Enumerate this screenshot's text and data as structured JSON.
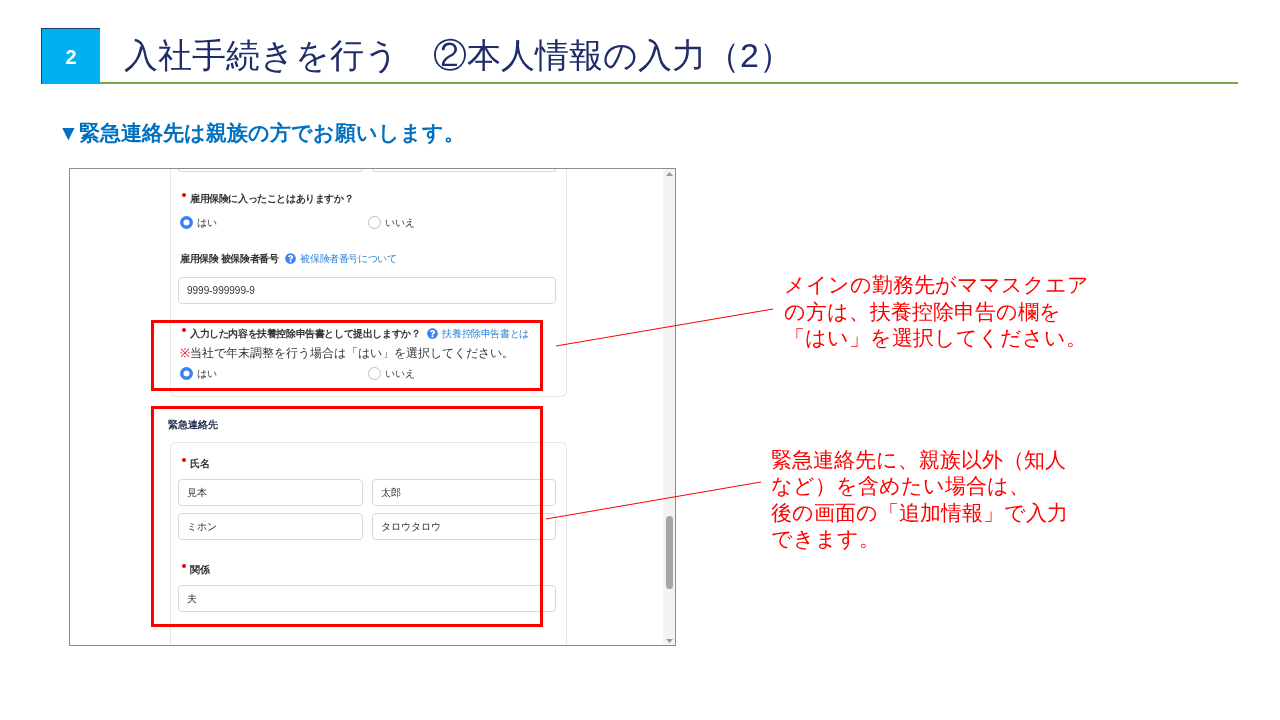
{
  "header": {
    "number": "2",
    "title": "入社手続きを行う　②本人情報の入力（2）"
  },
  "subtitle": "▼緊急連絡先は親族の方でお願いします。",
  "form": {
    "section_1": {
      "items": [
        {
          "kind": "radio",
          "label": "雇用保険に入ったことはありますか？",
          "required": true,
          "options": [
            {
              "label": "はい",
              "selected": true
            },
            {
              "label": "いいえ",
              "selected": false
            }
          ]
        },
        {
          "kind": "text",
          "label": "雇用保険 被保険者番号",
          "required": false,
          "help_link": "被保険者番号について",
          "values": [
            "9999-999999-9"
          ]
        },
        {
          "kind": "radio",
          "label": "入力した内容を扶養控除申告書として提出しますか？",
          "required": true,
          "help_link": "扶養控除申告書とは",
          "note": {
            "mark": "※",
            "text": "当社で年末調整を行う場合は「はい」を選択してください。"
          },
          "options": [
            {
              "label": "はい",
              "selected": true
            },
            {
              "label": "いいえ",
              "selected": false
            }
          ]
        }
      ]
    },
    "emergency_contact": {
      "title": "緊急連絡先",
      "items": [
        {
          "kind": "text",
          "label": "氏名",
          "required": true,
          "values": [
            "見本",
            "太郎",
            "ミホン",
            "タロウタロウ"
          ]
        },
        {
          "kind": "text",
          "label": "関係",
          "required": true,
          "values": [
            "夫"
          ]
        }
      ]
    }
  },
  "callouts": [
    {
      "lines": [
        "メインの勤務先がママスクエア",
        "の方は、扶養控除申告の欄を",
        "「はい」を選択してください。"
      ]
    },
    {
      "lines": [
        "緊急連絡先に、親族以外（知人",
        "など）を含めたい場合は、",
        "後の画面の「追加情報」で入力",
        "できます。"
      ]
    }
  ]
}
